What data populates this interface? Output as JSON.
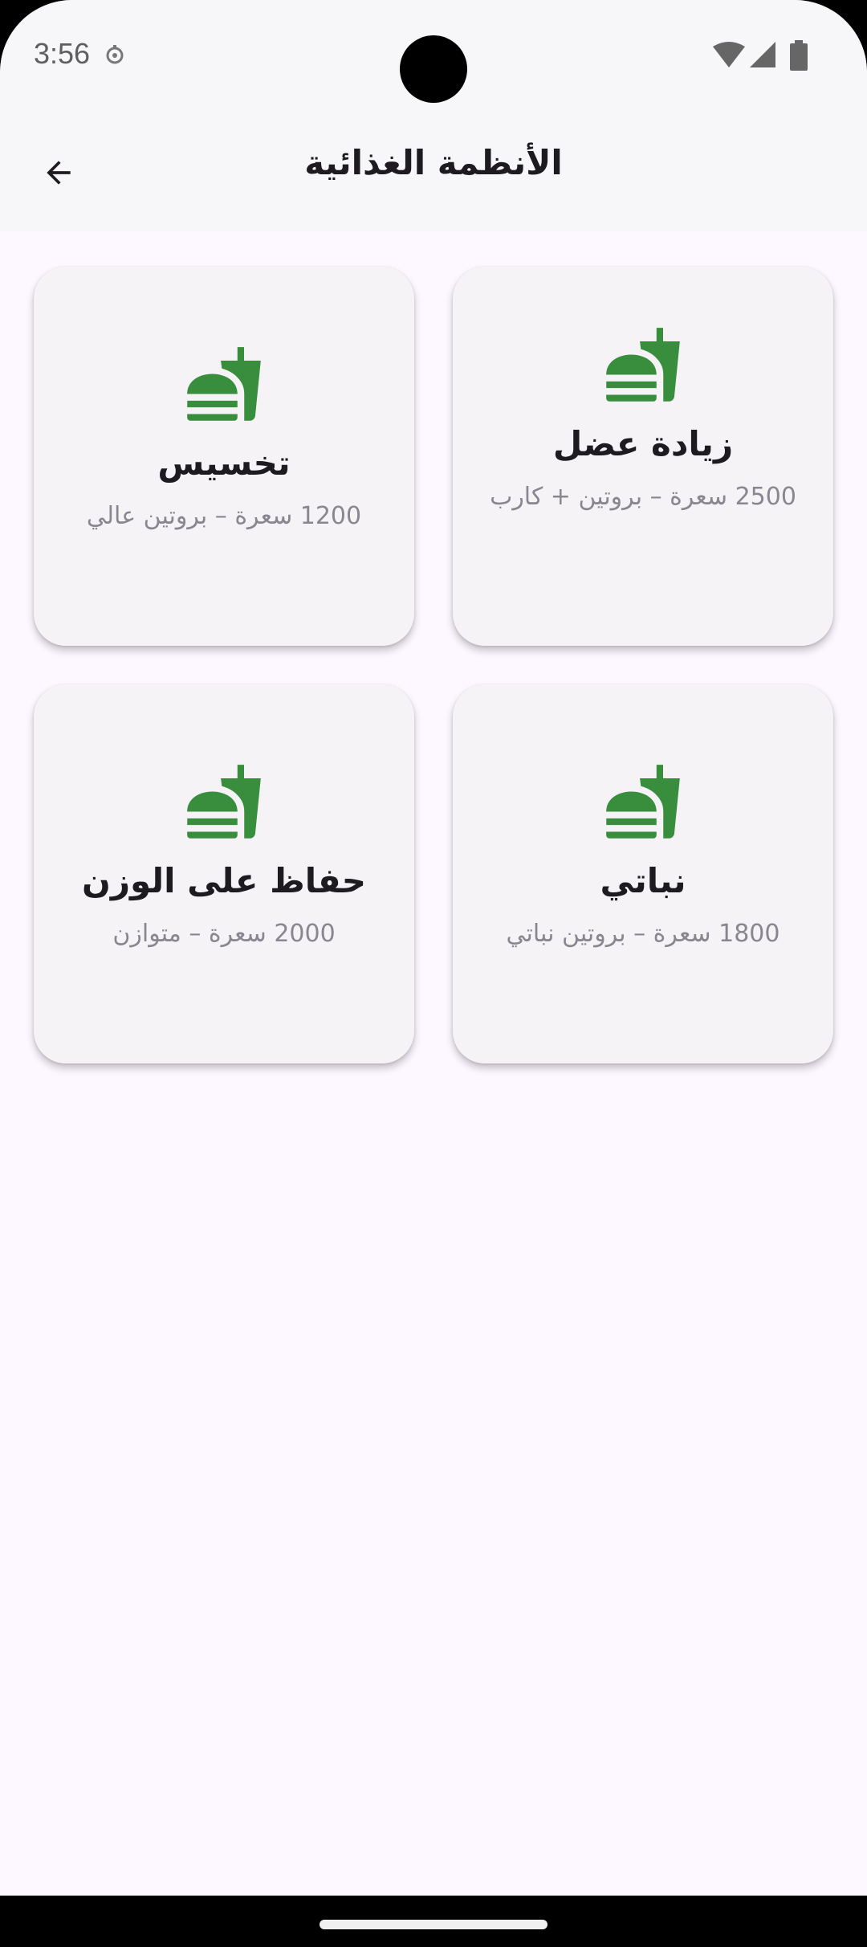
{
  "status_bar": {
    "time": "3:56",
    "icons": [
      "notification-icon",
      "wifi-icon",
      "signal-icon",
      "battery-icon"
    ]
  },
  "app_bar": {
    "title": "الأنظمة الغذائية",
    "back_icon": "arrow-back-icon"
  },
  "colors": {
    "accent_green": "#388E3C",
    "background": "#FDF7FF",
    "card": "#F6F3F7"
  },
  "plans": [
    {
      "title": "زيادة عضل",
      "desc": "2500 سعرة – بروتين + كارب",
      "icon": "fastfood-icon"
    },
    {
      "title": "تخسيس",
      "desc": "1200 سعرة – بروتين عالي",
      "icon": "fastfood-icon"
    },
    {
      "title": "نباتي",
      "desc": "1800 سعرة – بروتين نباتي",
      "icon": "fastfood-icon"
    },
    {
      "title": "حفاظ على الوزن",
      "desc": "2000 سعرة – متوازن",
      "icon": "fastfood-icon"
    }
  ]
}
